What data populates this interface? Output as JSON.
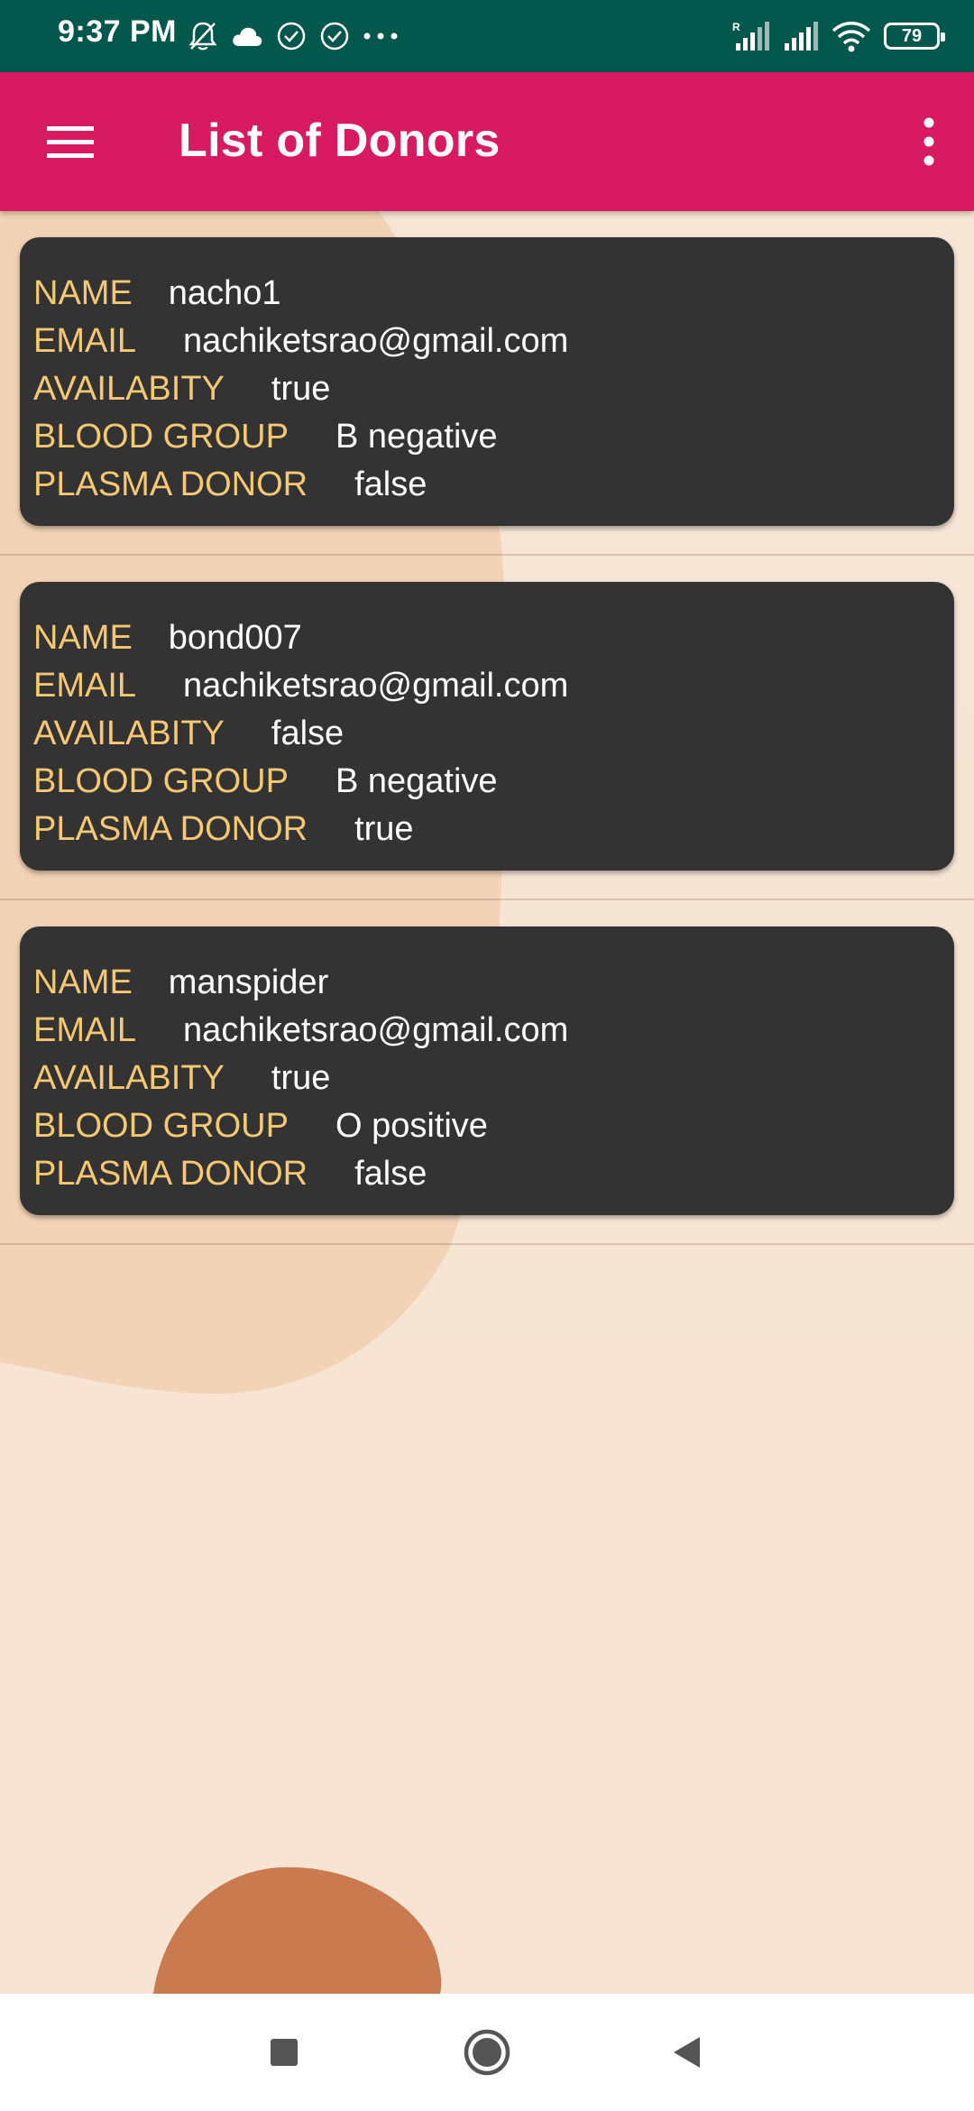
{
  "status_bar": {
    "time": "9:37 PM",
    "battery": "79",
    "icons": [
      "bell-off-icon",
      "cloud-icon",
      "check-circle-icon",
      "check-circle-icon",
      "more-dots-icon",
      "signal-r-icon",
      "signal-icon",
      "wifi-icon",
      "battery-icon"
    ]
  },
  "app_bar": {
    "title": "List of Donors",
    "menu_icon": "hamburger-menu-icon",
    "overflow_icon": "more-vertical-icon",
    "color": "#d81b60"
  },
  "labels": {
    "name": "NAME",
    "email": "EMAIL",
    "availability": "AVAILABITY",
    "blood_group": "BLOOD GROUP",
    "plasma_donor": "PLASMA DONOR"
  },
  "donors": [
    {
      "name": "nacho1",
      "email": "nachiketsrao@gmail.com",
      "availability": "true",
      "blood_group": "B negative",
      "plasma_donor": "false"
    },
    {
      "name": "bond007",
      "email": "nachiketsrao@gmail.com",
      "availability": "false",
      "blood_group": "B negative",
      "plasma_donor": "true"
    },
    {
      "name": "manspider",
      "email": "nachiketsrao@gmail.com",
      "availability": "true",
      "blood_group": "O positive",
      "plasma_donor": "false"
    }
  ],
  "nav_bar": {
    "icons": [
      "recents-square-icon",
      "home-circle-icon",
      "back-triangle-icon"
    ]
  },
  "colors": {
    "status_bar": "#01574b",
    "card": "#333333",
    "label": "#f7c873",
    "background": "#f6e3d3"
  }
}
